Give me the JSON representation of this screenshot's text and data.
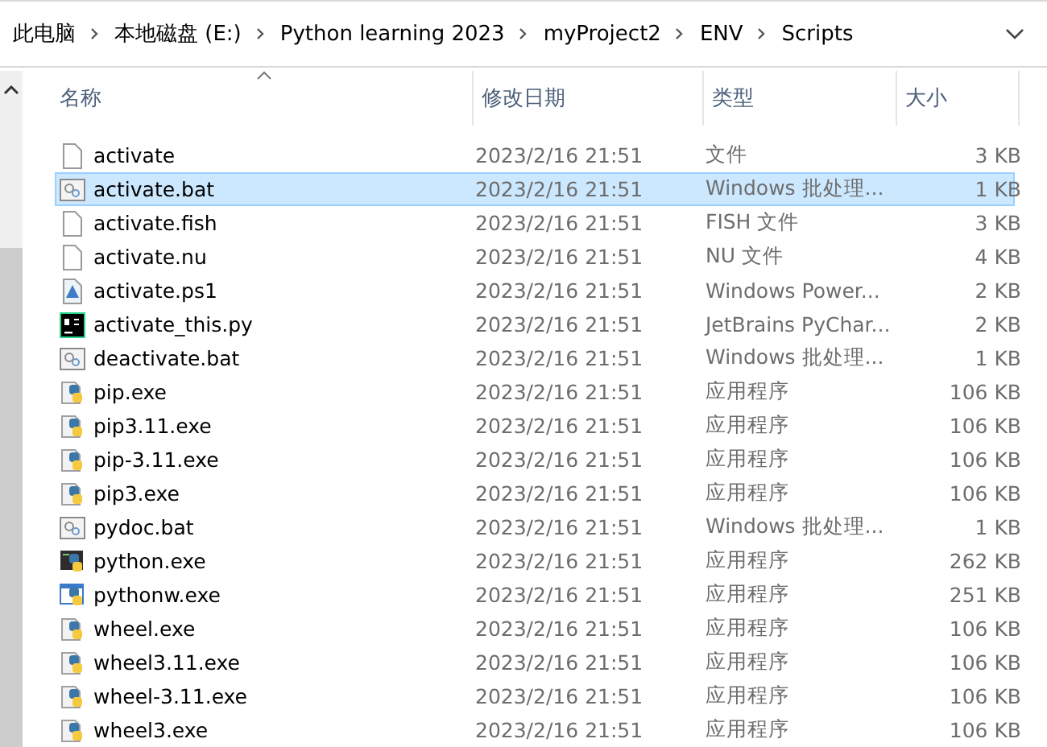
{
  "breadcrumbs": [
    "此电脑",
    "本地磁盘 (E:)",
    "Python learning 2023",
    "myProject2",
    "ENV",
    "Scripts"
  ],
  "columns": [
    {
      "label": "名称",
      "sorted": true
    },
    {
      "label": "修改日期",
      "sorted": false
    },
    {
      "label": "类型",
      "sorted": false
    },
    {
      "label": "大小",
      "sorted": false
    }
  ],
  "files": [
    {
      "name": "activate",
      "date": "2023/2/16 21:51",
      "type": "文件",
      "size": "3 KB",
      "kind": "text",
      "selected": false
    },
    {
      "name": "activate.bat",
      "date": "2023/2/16 21:51",
      "type": "Windows 批处理...",
      "size": "1 KB",
      "kind": "bat",
      "selected": true
    },
    {
      "name": "activate.fish",
      "date": "2023/2/16 21:51",
      "type": "FISH 文件",
      "size": "3 KB",
      "kind": "text",
      "selected": false
    },
    {
      "name": "activate.nu",
      "date": "2023/2/16 21:51",
      "type": "NU 文件",
      "size": "4 KB",
      "kind": "text",
      "selected": false
    },
    {
      "name": "activate.ps1",
      "date": "2023/2/16 21:51",
      "type": "Windows Power...",
      "size": "2 KB",
      "kind": "ps1",
      "selected": false
    },
    {
      "name": "activate_this.py",
      "date": "2023/2/16 21:51",
      "type": "JetBrains PyChar...",
      "size": "2 KB",
      "kind": "pycharm",
      "selected": false
    },
    {
      "name": "deactivate.bat",
      "date": "2023/2/16 21:51",
      "type": "Windows 批处理...",
      "size": "1 KB",
      "kind": "bat",
      "selected": false
    },
    {
      "name": "pip.exe",
      "date": "2023/2/16 21:51",
      "type": "应用程序",
      "size": "106 KB",
      "kind": "python",
      "selected": false
    },
    {
      "name": "pip3.11.exe",
      "date": "2023/2/16 21:51",
      "type": "应用程序",
      "size": "106 KB",
      "kind": "python",
      "selected": false
    },
    {
      "name": "pip-3.11.exe",
      "date": "2023/2/16 21:51",
      "type": "应用程序",
      "size": "106 KB",
      "kind": "python",
      "selected": false
    },
    {
      "name": "pip3.exe",
      "date": "2023/2/16 21:51",
      "type": "应用程序",
      "size": "106 KB",
      "kind": "python",
      "selected": false
    },
    {
      "name": "pydoc.bat",
      "date": "2023/2/16 21:51",
      "type": "Windows 批处理...",
      "size": "1 KB",
      "kind": "bat",
      "selected": false
    },
    {
      "name": "python.exe",
      "date": "2023/2/16 21:51",
      "type": "应用程序",
      "size": "262 KB",
      "kind": "console",
      "selected": false
    },
    {
      "name": "pythonw.exe",
      "date": "2023/2/16 21:51",
      "type": "应用程序",
      "size": "251 KB",
      "kind": "window",
      "selected": false
    },
    {
      "name": "wheel.exe",
      "date": "2023/2/16 21:51",
      "type": "应用程序",
      "size": "106 KB",
      "kind": "python",
      "selected": false
    },
    {
      "name": "wheel3.11.exe",
      "date": "2023/2/16 21:51",
      "type": "应用程序",
      "size": "106 KB",
      "kind": "python",
      "selected": false
    },
    {
      "name": "wheel-3.11.exe",
      "date": "2023/2/16 21:51",
      "type": "应用程序",
      "size": "106 KB",
      "kind": "python",
      "selected": false
    },
    {
      "name": "wheel3.exe",
      "date": "2023/2/16 21:51",
      "type": "应用程序",
      "size": "106 KB",
      "kind": "python",
      "selected": false
    }
  ]
}
